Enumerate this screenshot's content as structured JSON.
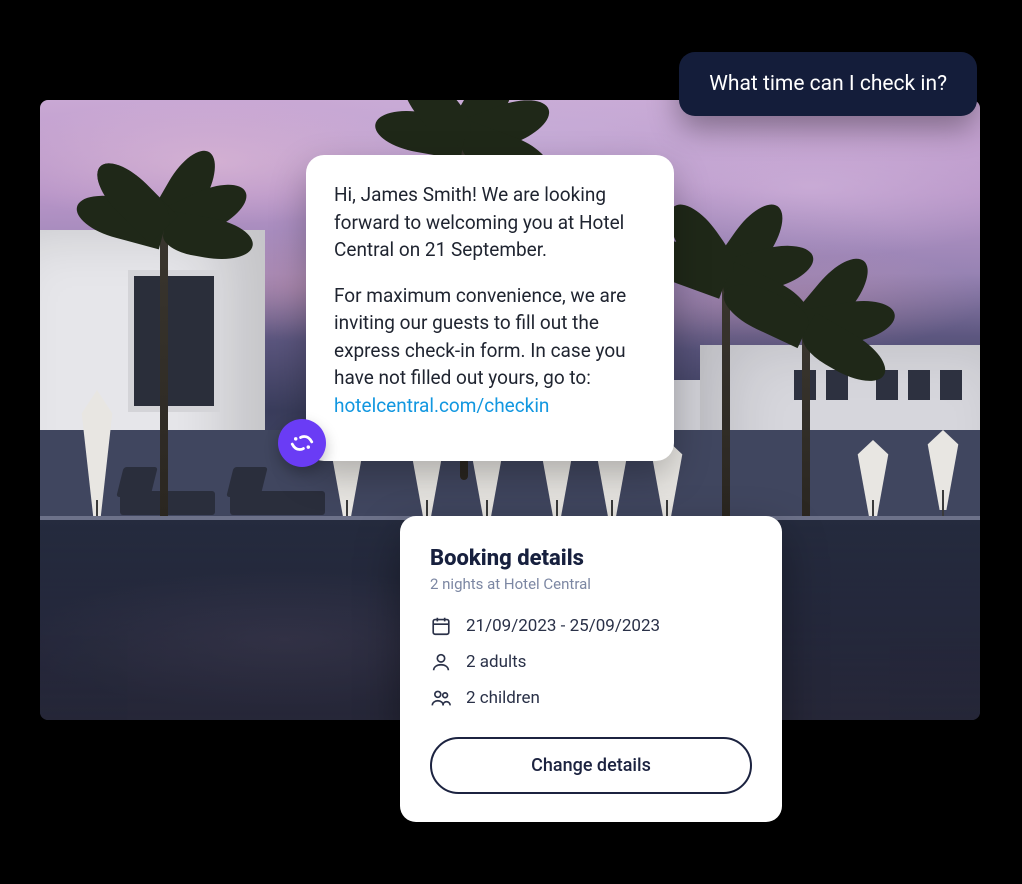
{
  "chat": {
    "user_message": "What time can I check in?",
    "assistant_message": {
      "para1": "Hi, James Smith! We are looking forward to welcoming you at Hotel Central on 21 September.",
      "para2_prefix": "For maximum convenience, we are inviting our guests to fill out the express check-in form. In case you have not filled out yours, go to: ",
      "link_text": "hotelcentral.com/checkin"
    }
  },
  "booking": {
    "title": "Booking details",
    "subtitle": "2 nights at Hotel Central",
    "dates": "21/09/2023 - 25/09/2023",
    "adults": "2 adults",
    "children": "2 children",
    "button": "Change details"
  }
}
